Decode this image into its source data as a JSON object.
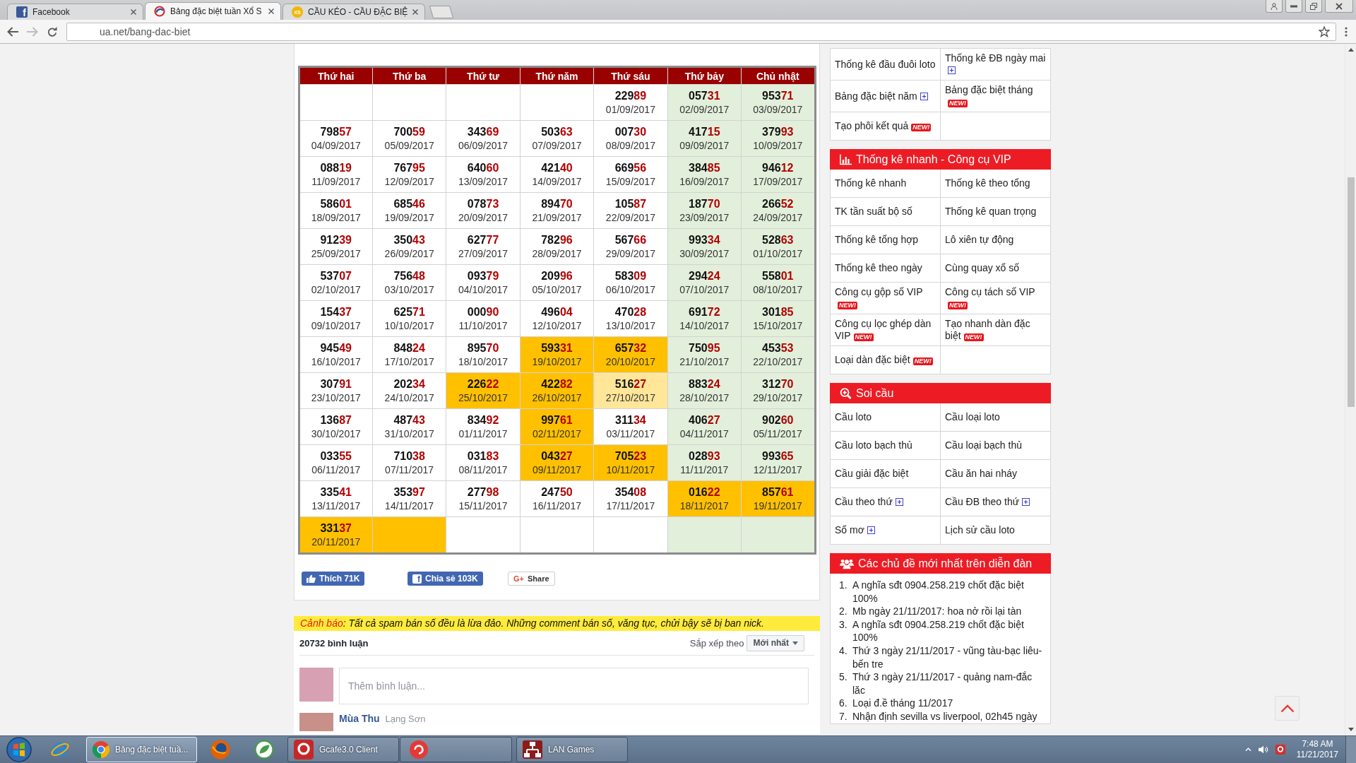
{
  "browser": {
    "tabs": [
      {
        "kind": "facebook",
        "logo": "f",
        "title": "Facebook",
        "selected": false
      },
      {
        "kind": "swirl",
        "title": "Bảng đặc biệt tuần Xổ S",
        "selected": true
      },
      {
        "kind": "badge",
        "logo": "XS",
        "title": "CẦU KÉO - CẦU ĐẶC BIỆ",
        "selected": false
      }
    ],
    "url": "ua.net/bang-dac-biet"
  },
  "calendar": {
    "columns": [
      "Thứ hai",
      "Thứ ba",
      "Thứ tư",
      "Thứ năm",
      "Thứ sáu",
      "Thứ bảy",
      "Chủ nhật"
    ],
    "rows": [
      [
        {
          "color": "#ffffff"
        },
        {
          "color": "#ffffff"
        },
        {
          "color": "#ffffff"
        },
        {
          "color": "#ffffff"
        },
        {
          "number": "22989",
          "date": "01/09/2017",
          "color": "#ffffff"
        },
        {
          "number": "05731",
          "date": "02/09/2017",
          "color": "#e2efda"
        },
        {
          "number": "95371",
          "date": "03/09/2017",
          "color": "#e2efda"
        }
      ],
      [
        {
          "number": "79857",
          "date": "04/09/2017",
          "color": "#ffffff"
        },
        {
          "number": "70059",
          "date": "05/09/2017",
          "color": "#ffffff"
        },
        {
          "number": "34369",
          "date": "06/09/2017",
          "color": "#ffffff"
        },
        {
          "number": "50363",
          "date": "07/09/2017",
          "color": "#ffffff"
        },
        {
          "number": "00730",
          "date": "08/09/2017",
          "color": "#ffffff"
        },
        {
          "number": "41715",
          "date": "09/09/2017",
          "color": "#e2efda"
        },
        {
          "number": "37993",
          "date": "10/09/2017",
          "color": "#e2efda"
        }
      ],
      [
        {
          "number": "08819",
          "date": "11/09/2017",
          "color": "#ffffff"
        },
        {
          "number": "76795",
          "date": "12/09/2017",
          "color": "#ffffff"
        },
        {
          "number": "64060",
          "date": "13/09/2017",
          "color": "#ffffff"
        },
        {
          "number": "42140",
          "date": "14/09/2017",
          "color": "#ffffff"
        },
        {
          "number": "66956",
          "date": "15/09/2017",
          "color": "#ffffff"
        },
        {
          "number": "38485",
          "date": "16/09/2017",
          "color": "#e2efda"
        },
        {
          "number": "94612",
          "date": "17/09/2017",
          "color": "#e2efda"
        }
      ],
      [
        {
          "number": "58601",
          "date": "18/09/2017",
          "color": "#ffffff"
        },
        {
          "number": "68546",
          "date": "19/09/2017",
          "color": "#ffffff"
        },
        {
          "number": "07873",
          "date": "20/09/2017",
          "color": "#ffffff"
        },
        {
          "number": "89470",
          "date": "21/09/2017",
          "color": "#ffffff"
        },
        {
          "number": "10587",
          "date": "22/09/2017",
          "color": "#ffffff"
        },
        {
          "number": "18770",
          "date": "23/09/2017",
          "color": "#e2efda"
        },
        {
          "number": "26652",
          "date": "24/09/2017",
          "color": "#e2efda"
        }
      ],
      [
        {
          "number": "91239",
          "date": "25/09/2017",
          "color": "#ffffff"
        },
        {
          "number": "35043",
          "date": "26/09/2017",
          "color": "#ffffff"
        },
        {
          "number": "62777",
          "date": "27/09/2017",
          "color": "#ffffff"
        },
        {
          "number": "78296",
          "date": "28/09/2017",
          "color": "#ffffff"
        },
        {
          "number": "56766",
          "date": "29/09/2017",
          "color": "#ffffff"
        },
        {
          "number": "99334",
          "date": "30/09/2017",
          "color": "#e2efda"
        },
        {
          "number": "52863",
          "date": "01/10/2017",
          "color": "#e2efda"
        }
      ],
      [
        {
          "number": "53707",
          "date": "02/10/2017",
          "color": "#ffffff"
        },
        {
          "number": "75648",
          "date": "03/10/2017",
          "color": "#ffffff"
        },
        {
          "number": "09379",
          "date": "04/10/2017",
          "color": "#ffffff"
        },
        {
          "number": "20996",
          "date": "05/10/2017",
          "color": "#ffffff"
        },
        {
          "number": "58309",
          "date": "06/10/2017",
          "color": "#ffffff"
        },
        {
          "number": "29424",
          "date": "07/10/2017",
          "color": "#e2efda"
        },
        {
          "number": "55801",
          "date": "08/10/2017",
          "color": "#e2efda"
        }
      ],
      [
        {
          "number": "15437",
          "date": "09/10/2017",
          "color": "#ffffff"
        },
        {
          "number": "62571",
          "date": "10/10/2017",
          "color": "#ffffff"
        },
        {
          "number": "00090",
          "date": "11/10/2017",
          "color": "#ffffff"
        },
        {
          "number": "49604",
          "date": "12/10/2017",
          "color": "#ffffff"
        },
        {
          "number": "47028",
          "date": "13/10/2017",
          "color": "#ffffff"
        },
        {
          "number": "69172",
          "date": "14/10/2017",
          "color": "#e2efda"
        },
        {
          "number": "30185",
          "date": "15/10/2017",
          "color": "#e2efda"
        }
      ],
      [
        {
          "number": "94549",
          "date": "16/10/2017",
          "color": "#ffffff"
        },
        {
          "number": "84824",
          "date": "17/10/2017",
          "color": "#ffffff"
        },
        {
          "number": "89570",
          "date": "18/10/2017",
          "color": "#ffffff"
        },
        {
          "number": "59331",
          "date": "19/10/2017",
          "color": "#ffc000"
        },
        {
          "number": "65732",
          "date": "20/10/2017",
          "color": "#ffc000"
        },
        {
          "number": "75095",
          "date": "21/10/2017",
          "color": "#e2efda"
        },
        {
          "number": "45353",
          "date": "22/10/2017",
          "color": "#e2efda"
        }
      ],
      [
        {
          "number": "30791",
          "date": "23/10/2017",
          "color": "#ffffff"
        },
        {
          "number": "20234",
          "date": "24/10/2017",
          "color": "#ffffff"
        },
        {
          "number": "22622",
          "date": "25/10/2017",
          "color": "#ffc000"
        },
        {
          "number": "42282",
          "date": "26/10/2017",
          "color": "#ffc000"
        },
        {
          "number": "51627",
          "date": "27/10/2017",
          "color": "#ffe699"
        },
        {
          "number": "88324",
          "date": "28/10/2017",
          "color": "#e2efda"
        },
        {
          "number": "31270",
          "date": "29/10/2017",
          "color": "#e2efda"
        }
      ],
      [
        {
          "number": "13687",
          "date": "30/10/2017",
          "color": "#ffffff"
        },
        {
          "number": "48743",
          "date": "31/10/2017",
          "color": "#ffffff"
        },
        {
          "number": "83492",
          "date": "01/11/2017",
          "color": "#ffffff"
        },
        {
          "number": "99761",
          "date": "02/11/2017",
          "color": "#ffc000"
        },
        {
          "number": "31134",
          "date": "03/11/2017",
          "color": "#ffffff"
        },
        {
          "number": "40627",
          "date": "04/11/2017",
          "color": "#e2efda"
        },
        {
          "number": "90260",
          "date": "05/11/2017",
          "color": "#e2efda"
        }
      ],
      [
        {
          "number": "03355",
          "date": "06/11/2017",
          "color": "#ffffff"
        },
        {
          "number": "71038",
          "date": "07/11/2017",
          "color": "#ffffff"
        },
        {
          "number": "03183",
          "date": "08/11/2017",
          "color": "#ffffff"
        },
        {
          "number": "04327",
          "date": "09/11/2017",
          "color": "#ffc000"
        },
        {
          "number": "70523",
          "date": "10/11/2017",
          "color": "#ffc000"
        },
        {
          "number": "02893",
          "date": "11/11/2017",
          "color": "#e2efda"
        },
        {
          "number": "99365",
          "date": "12/11/2017",
          "color": "#e2efda"
        }
      ],
      [
        {
          "number": "33541",
          "date": "13/11/2017",
          "color": "#ffffff"
        },
        {
          "number": "35397",
          "date": "14/11/2017",
          "color": "#ffffff"
        },
        {
          "number": "27798",
          "date": "15/11/2017",
          "color": "#ffffff"
        },
        {
          "number": "24750",
          "date": "16/11/2017",
          "color": "#ffffff"
        },
        {
          "number": "35408",
          "date": "17/11/2017",
          "color": "#ffffff"
        },
        {
          "number": "01622",
          "date": "18/11/2017",
          "color": "#ffc000"
        },
        {
          "number": "85761",
          "date": "19/11/2017",
          "color": "#ffc000"
        }
      ],
      [
        {
          "number": "33137",
          "date": "20/11/2017",
          "color": "#ffc000"
        },
        {
          "color": "#ffc000"
        },
        {
          "color": "#ffffff"
        },
        {
          "color": "#ffffff"
        },
        {
          "color": "#ffffff"
        },
        {
          "color": "#e2efda"
        },
        {
          "color": "#e2efda"
        }
      ]
    ]
  },
  "share_buttons": [
    {
      "kind": "like",
      "label": "Thích 71K"
    },
    {
      "kind": "facebook",
      "logo": "f",
      "label": "Chia sẻ 103K"
    },
    {
      "kind": "google",
      "logo": "G+",
      "label": "Share"
    }
  ],
  "comments": {
    "warning": {
      "label": "Cảnh báo",
      "text": ": Tất cả spam bán số đều là lừa đảo. Những comment bán số, văng tục, chửi bậy sẽ bị ban nick."
    },
    "count": "20732 bình luận",
    "sort_label": "Sắp xếp theo",
    "sort_value": "Mới nhất",
    "composer": {
      "placeholder": "Thêm bình luận..."
    },
    "comment": {
      "author": "Mùa Thu",
      "location": "Lạng Sơn"
    }
  },
  "sidebar": {
    "link_table": [
      [
        {
          "label": "Thống kê đầu đuôi loto",
          "expandable": false
        },
        {
          "label": "Thống kê ĐB ngày mai",
          "expandable": true
        }
      ],
      [
        {
          "label": "Bảng đặc biệt năm",
          "expandable": true
        },
        {
          "label": "Bảng đặc biệt tháng",
          "expandable": false,
          "badge": "NEW!"
        }
      ],
      [
        {
          "label": "Tạo phôi kết quả",
          "expandable": false,
          "badge": "NEW!"
        }
      ]
    ],
    "sections": [
      {
        "title": "Thống kê nhanh - Công cụ VIP",
        "kind": "stats",
        "rows": [
          [
            {
              "label": "Thống kê nhanh",
              "expandable": false
            },
            {
              "label": "Thống kê theo tổng",
              "expandable": false
            }
          ],
          [
            {
              "label": "TK tần suất bộ số",
              "expandable": false
            },
            {
              "label": "Thống kê quan trọng",
              "expandable": false
            }
          ],
          [
            {
              "label": "Thống kê tổng hợp",
              "expandable": false
            },
            {
              "label": "Lô xiên tự động",
              "expandable": false
            }
          ],
          [
            {
              "label": "Thống kê theo ngày",
              "expandable": false
            },
            {
              "label": "Cùng quay xổ số",
              "expandable": false
            }
          ],
          [
            {
              "label": "Công cụ gộp số VIP",
              "expandable": false,
              "badge": "NEW!"
            },
            {
              "label": "Công cụ tách số VIP",
              "expandable": false,
              "badge": "NEW!"
            }
          ],
          [
            {
              "label": "Công cụ lọc ghép dàn VIP",
              "expandable": false,
              "badge": "NEW!"
            },
            {
              "label": "Tạo nhanh dàn đặc biệt",
              "expandable": false,
              "badge": "NEW!"
            }
          ],
          [
            {
              "label": "Loại dàn đặc biệt",
              "expandable": false,
              "badge": "NEW!"
            }
          ]
        ]
      },
      {
        "title": "Soi cầu",
        "kind": "search",
        "rows": [
          [
            {
              "label": "Cầu loto",
              "expandable": false
            },
            {
              "label": "Cầu loại loto",
              "expandable": false
            }
          ],
          [
            {
              "label": "Cầu loto bạch thủ",
              "expandable": false
            },
            {
              "label": "Cầu loại bạch thủ",
              "expandable": false
            }
          ],
          [
            {
              "label": "Cầu giải đặc biệt",
              "expandable": false
            },
            {
              "label": "Cầu ăn hai nháy",
              "expandable": false
            }
          ],
          [
            {
              "label": "Cầu theo thứ",
              "expandable": true
            },
            {
              "label": "Cầu ĐB theo thứ",
              "expandable": true
            }
          ],
          [
            {
              "label": "Sổ mơ",
              "expandable": true
            },
            {
              "label": "Lịch sử cầu loto",
              "expandable": false
            }
          ]
        ]
      }
    ],
    "forum": {
      "title": "Các chủ đề mới nhất trên diễn đàn",
      "kind": "community",
      "topics": [
        {
          "number": "1.",
          "text": "A nghĩa sđt 0904.258.219 chốt đặc biệt 100%"
        },
        {
          "number": "2.",
          "text": "Mb ngày 21/11/2017: hoa nở rồi lại tàn"
        },
        {
          "number": "3.",
          "text": "A nghĩa sđt 0904.258.219 chốt đặc biệt 100%"
        },
        {
          "number": "4.",
          "text": "Thứ 3 ngày 21/11/2017 - vũng tàu-bạc liêu-bến tre"
        },
        {
          "number": "5.",
          "text": "Thứ 3 ngày 21/11/2017 - quảng nam-đắc lăc"
        },
        {
          "number": "6.",
          "text": "Loại đ.ề tháng 11/2017"
        },
        {
          "number": "7.",
          "text": "Nhận định sevilla vs liverpool, 02h45 ngày"
        }
      ]
    }
  },
  "taskbar": {
    "items": [
      {
        "kind": "start",
        "selected": false
      },
      {
        "kind": "ie",
        "selected": false
      },
      {
        "kind": "chrome",
        "label": "Bảng đặc biệt tuầ...",
        "selected": true
      },
      {
        "kind": "firefox",
        "selected": false
      },
      {
        "kind": "green",
        "selected": false
      },
      {
        "kind": "gcafe",
        "label": "Gcafe3.0 Client",
        "selected": false
      },
      {
        "kind": "garena",
        "selected": false
      },
      {
        "kind": "lan",
        "label": "LAN Games",
        "selected": false
      }
    ],
    "tray": [
      {
        "kind": "chevron"
      },
      {
        "kind": "speaker"
      },
      {
        "kind": "app"
      }
    ],
    "time": "7:48 AM",
    "date": "11/21/2017"
  }
}
